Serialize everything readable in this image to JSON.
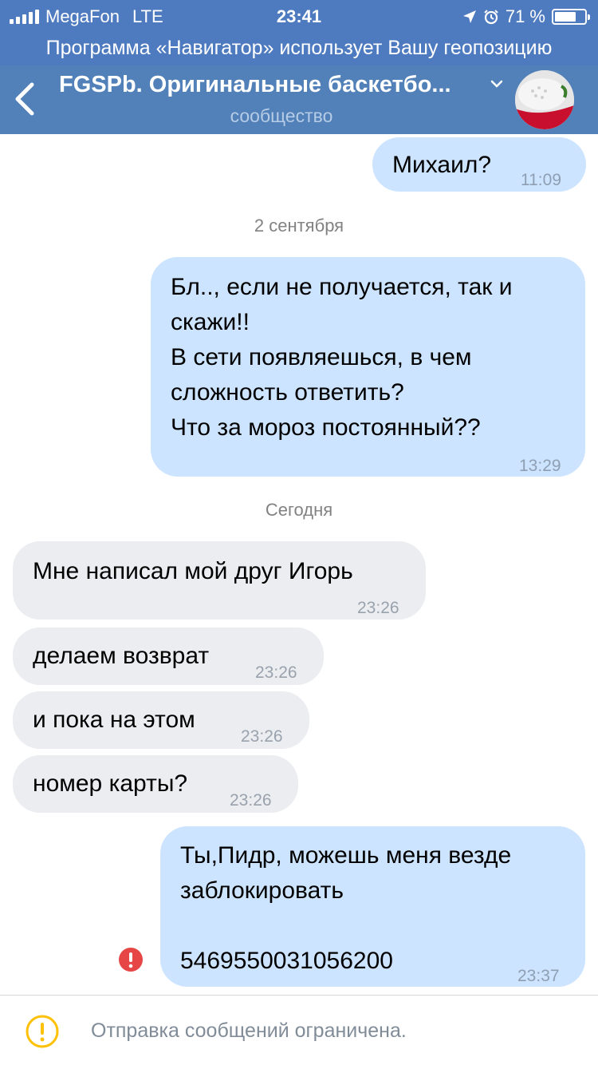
{
  "status_bar": {
    "carrier": "MegaFon",
    "network": "LTE",
    "time": "23:41",
    "battery": "71 %",
    "battery_level": 0.71,
    "icons": [
      "signal-icon",
      "location-arrow-icon",
      "alarm-icon",
      "battery-icon"
    ]
  },
  "geo_banner": "Программа «Навигатор» использует Вашу геопозицию",
  "header": {
    "title": "FGSPb. Оригинальные баскетбо...",
    "subtitle": "сообщество",
    "colors": {
      "bar": "#5181b8",
      "status": "#4e7bbf"
    }
  },
  "messages": [
    {
      "direction": "out",
      "text": "Михаил?",
      "time": "11:09"
    },
    {
      "direction": "out",
      "text": "Бл.., если не получается, так и\nскажи!!\nВ сети появляешься, в чем\nсложность ответить?\nЧто за мороз постоянный??",
      "time": "13:29"
    },
    {
      "direction": "in",
      "text": "Мне написал мой друг Игорь",
      "time": "23:26"
    },
    {
      "direction": "in",
      "text": "делаем возврат",
      "time": "23:26"
    },
    {
      "direction": "in",
      "text": "и пока на этом",
      "time": "23:26"
    },
    {
      "direction": "in",
      "text": "номер карты?",
      "time": "23:26"
    },
    {
      "direction": "out",
      "text": "Ты,Пидр, можешь меня везде\nзаблокировать\n\n5469550031056200",
      "time": "23:37",
      "failed": true
    }
  ],
  "date_separators": [
    "2 сентября",
    "Сегодня"
  ],
  "footer": {
    "text": "Отправка сообщений ограничена."
  },
  "colors": {
    "outgoing_bubble": "#cce4ff",
    "incoming_bubble": "#ebedf0",
    "error": "#e64646",
    "warning": "#ffc107"
  }
}
